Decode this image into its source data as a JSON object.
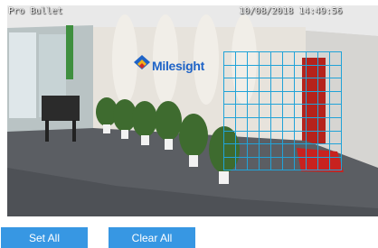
{
  "video": {
    "osd_title": "Pro Bullet",
    "osd_timestamp": "10/08/2018 14:49:56",
    "logo_text": "Milesight"
  },
  "motion_grid": {
    "columns": 10,
    "rows": 9,
    "line_color": "#21a3d8"
  },
  "buttons": {
    "set_all": "Set All",
    "clear_all": "Clear All"
  },
  "colors": {
    "button_bg": "#3797e3",
    "button_text": "#ffffff"
  }
}
